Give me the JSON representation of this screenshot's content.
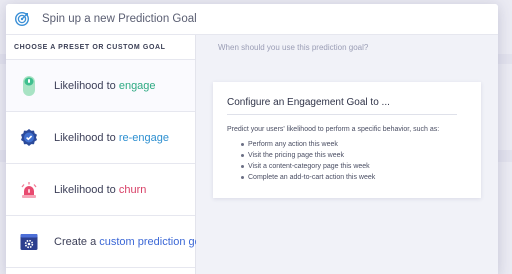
{
  "header": {
    "title": "Spin up a new Prediction Goal",
    "icon": "target-icon"
  },
  "left_panel": {
    "heading": "CHOOSE A PRESET OR CUSTOM GOAL",
    "options": [
      {
        "prefix": "Likelihood to ",
        "keyword": "engage",
        "icon": "engage-icon",
        "keyword_color": "#2faa83"
      },
      {
        "prefix": "Likelihood to ",
        "keyword": "re-engage",
        "icon": "re-engage-badge-icon",
        "keyword_color": "#2d8fd0"
      },
      {
        "prefix": "Likelihood to ",
        "keyword": "churn",
        "icon": "alarm-siren-icon",
        "keyword_color": "#d83f66"
      },
      {
        "prefix": "Create a ",
        "keyword": "custom prediction goal",
        "icon": "custom-gear-window-icon",
        "keyword_color": "#3c68d6"
      }
    ]
  },
  "right_panel": {
    "heading": "When should you use this prediction goal?",
    "card": {
      "title": "Configure an Engagement Goal to ...",
      "description": "Predict your users' likelihood to perform a specific behavior, such as:",
      "items": [
        "Perform any action this week",
        "Visit the pricing page this week",
        "Visit a content-category page this week",
        "Complete an add-to-cart action this week"
      ]
    }
  }
}
